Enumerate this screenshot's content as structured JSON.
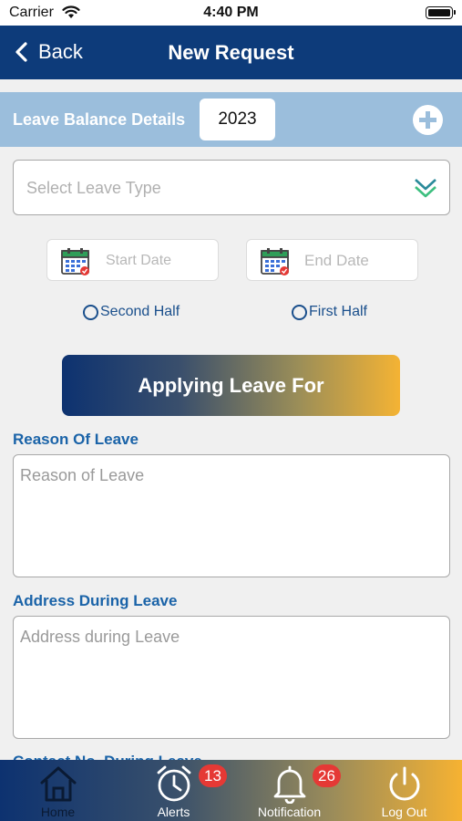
{
  "status_bar": {
    "carrier": "Carrier",
    "time": "4:40 PM"
  },
  "nav": {
    "back_label": "Back",
    "title": "New Request"
  },
  "balance": {
    "label": "Leave Balance Details",
    "year": "2023"
  },
  "leave_type": {
    "placeholder": "Select Leave Type"
  },
  "dates": {
    "start_placeholder": "Start Date",
    "end_placeholder": "End Date"
  },
  "half_day": {
    "second_half": "Second Half",
    "first_half": "First Half"
  },
  "apply_button": "Applying Leave For",
  "reason": {
    "label": "Reason Of Leave",
    "placeholder": "Reason of Leave"
  },
  "address": {
    "label": "Address During Leave",
    "placeholder": "Address during Leave"
  },
  "contact": {
    "label": "Contact No. During Leave"
  },
  "tabs": [
    {
      "label": "Home",
      "icon": "home-icon"
    },
    {
      "label": "Alerts",
      "icon": "alarm-clock-icon",
      "badge": "13"
    },
    {
      "label": "Notification",
      "icon": "bell-icon",
      "badge": "26"
    },
    {
      "label": "Log Out",
      "icon": "power-icon"
    }
  ],
  "colors": {
    "nav": "#0d3b7a",
    "balance_bar": "#9bbedc",
    "label_blue": "#1a63a8",
    "gradient_start": "#0d3270",
    "gradient_end": "#f6b232",
    "badge": "#e53935"
  }
}
